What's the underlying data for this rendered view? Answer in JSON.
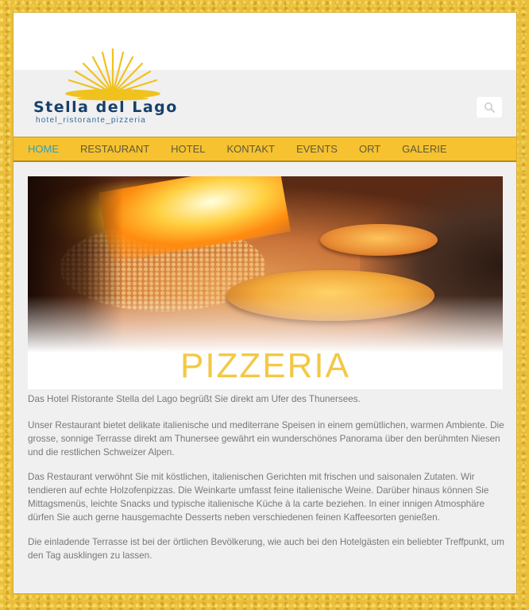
{
  "brand": {
    "name": "Stella del Lago",
    "tagline": "hotel_ristorante_pizzeria",
    "sun_color": "#f0c21e",
    "name_color": "#17406b"
  },
  "search": {
    "icon": "search-icon"
  },
  "nav": {
    "items": [
      {
        "label": "HOME",
        "active": true
      },
      {
        "label": "RESTAURANT",
        "active": false
      },
      {
        "label": "HOTEL",
        "active": false
      },
      {
        "label": "KONTAKT",
        "active": false
      },
      {
        "label": "EVENTS",
        "active": false
      },
      {
        "label": "ORT",
        "active": false
      },
      {
        "label": "GALERIE",
        "active": false
      }
    ],
    "background": "#f6c230",
    "active_color": "#2e9fc0"
  },
  "hero": {
    "title": "PIZZERIA",
    "title_color": "#f3c844"
  },
  "content": {
    "paragraphs": [
      "Das Hotel Ristorante Stella del Lago begrüßt Sie direkt am Ufer des Thunersees.",
      "Unser Restaurant bietet delikate italienische und mediterrane Speisen in einem gemütlichen, warmen Ambiente. Die grosse, sonnige Terrasse direkt am Thunersee gewährt ein wunderschönes Panorama über den berühmten Niesen und die restlichen Schweizer Alpen.",
      "Das Restaurant verwöhnt Sie mit köstlichen, italienischen Gerichten mit frischen und saisonalen Zutaten. Wir tendieren auf echte Holzofenpizzas. Die Weinkarte umfasst feine italienische Weine. Darüber hinaus können Sie Mittagsmenüs, leichte Snacks und typische italienische Küche à la carte beziehen. In einer innigen Atmosphäre dürfen Sie auch gerne hausgemachte Desserts neben verschiedenen feinen Kaffeesorten genießen.",
      "Die einladende Terrasse ist bei der örtlichen Bevölkerung, wie auch bei den Hotelgästen ein beliebter Treffpunkt, um den Tag ausklingen zu lassen."
    ]
  }
}
